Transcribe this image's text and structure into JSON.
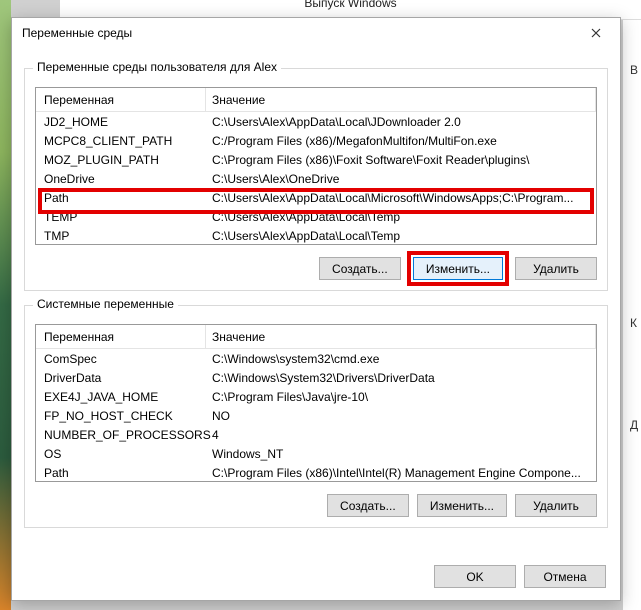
{
  "parent_window_title": "Выпуск Windows",
  "side_chars": {
    "c1": "В",
    "c2": "К",
    "c3": "Д"
  },
  "dialog": {
    "title": "Переменные среды",
    "user_group_label": "Переменные среды пользователя для Alex",
    "system_group_label": "Системные переменные",
    "col_variable": "Переменная",
    "col_value": "Значение",
    "btn_new": "Создать...",
    "btn_edit": "Изменить...",
    "btn_delete": "Удалить",
    "btn_ok": "OK",
    "btn_cancel": "Отмена"
  },
  "user_vars": [
    {
      "name": "JD2_HOME",
      "value": "C:\\Users\\Alex\\AppData\\Local\\JDownloader 2.0"
    },
    {
      "name": "MCPC8_CLIENT_PATH",
      "value": "C:/Program Files (x86)/MegafonMultifon/MultiFon.exe"
    },
    {
      "name": "MOZ_PLUGIN_PATH",
      "value": "C:\\Program Files (x86)\\Foxit Software\\Foxit Reader\\plugins\\"
    },
    {
      "name": "OneDrive",
      "value": "C:\\Users\\Alex\\OneDrive"
    },
    {
      "name": "Path",
      "value": "C:\\Users\\Alex\\AppData\\Local\\Microsoft\\WindowsApps;C:\\Program..."
    },
    {
      "name": "TEMP",
      "value": "C:\\Users\\Alex\\AppData\\Local\\Temp"
    },
    {
      "name": "TMP",
      "value": "C:\\Users\\Alex\\AppData\\Local\\Temp"
    }
  ],
  "system_vars": [
    {
      "name": "ComSpec",
      "value": "C:\\Windows\\system32\\cmd.exe"
    },
    {
      "name": "DriverData",
      "value": "C:\\Windows\\System32\\Drivers\\DriverData"
    },
    {
      "name": "EXE4J_JAVA_HOME",
      "value": "C:\\Program Files\\Java\\jre-10\\"
    },
    {
      "name": "FP_NO_HOST_CHECK",
      "value": "NO"
    },
    {
      "name": "NUMBER_OF_PROCESSORS",
      "value": "4"
    },
    {
      "name": "OS",
      "value": "Windows_NT"
    },
    {
      "name": "Path",
      "value": "C:\\Program Files (x86)\\Intel\\Intel(R) Management Engine Compone..."
    }
  ]
}
